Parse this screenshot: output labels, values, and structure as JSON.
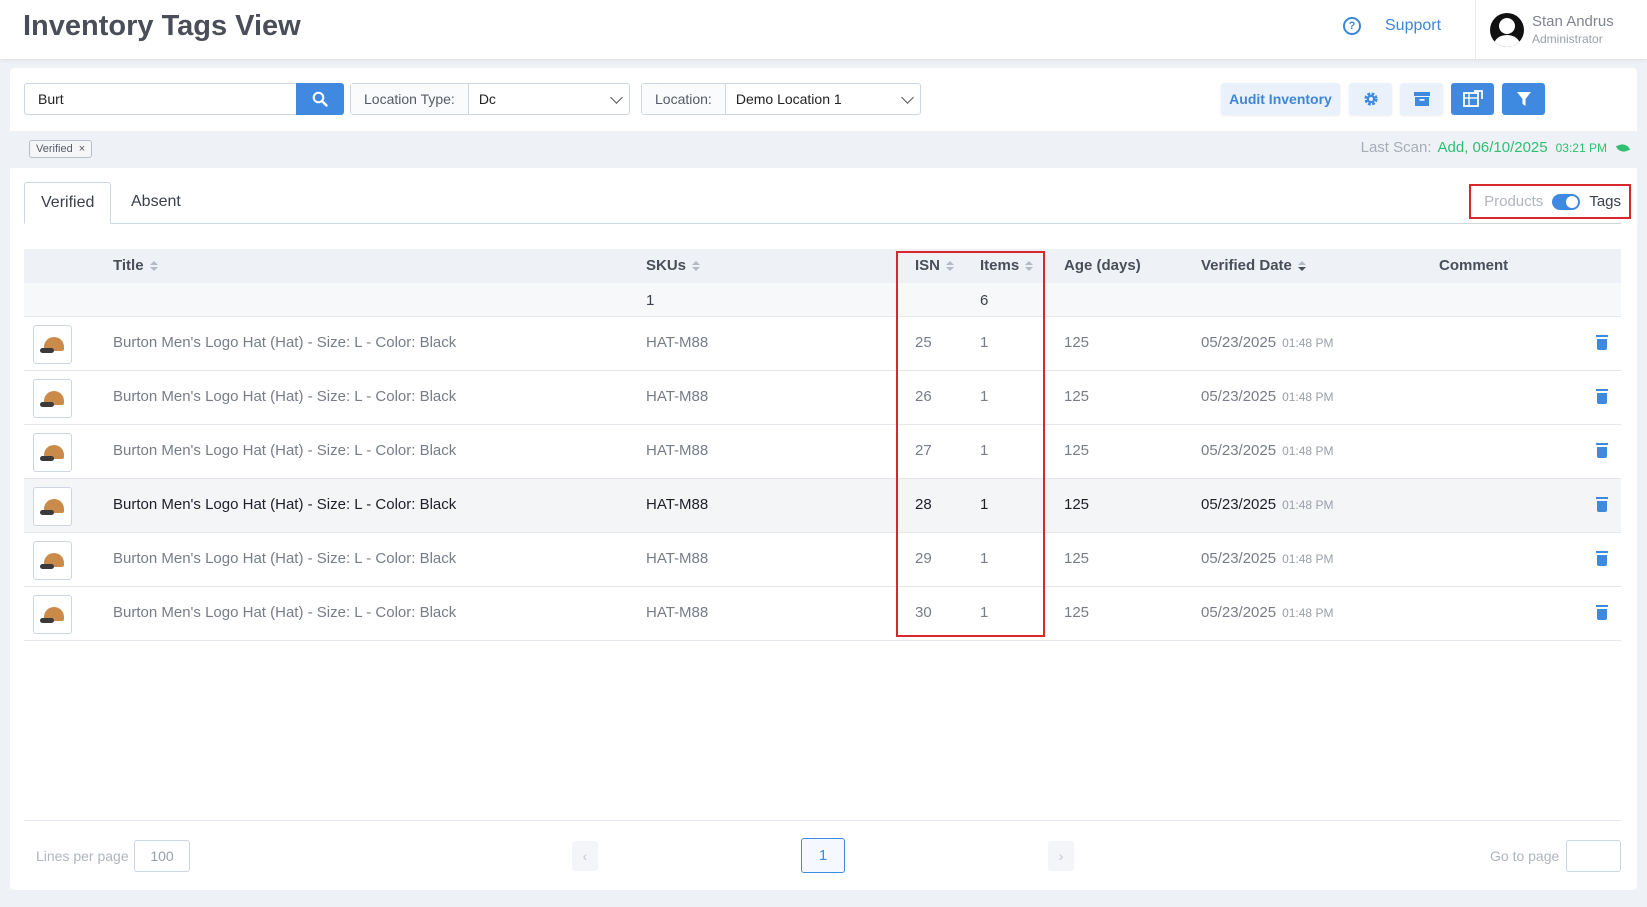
{
  "header": {
    "title": "Inventory Tags View",
    "support_label": "Support",
    "help_icon": "?",
    "user_name": "Stan Andrus",
    "user_role": "Administrator"
  },
  "toolbar": {
    "search_value": "Burt",
    "location_type_label": "Location Type:",
    "location_type_value": "Dc",
    "location_label": "Location:",
    "location_value": "Demo Location 1",
    "audit_label": "Audit Inventory"
  },
  "filters": {
    "chip_label": "Verified",
    "chip_close": "×",
    "last_scan_label": "Last Scan:",
    "last_scan_value": "Add, 06/10/2025",
    "last_scan_time": "03:21 PM"
  },
  "tabs": [
    {
      "label": "Verified"
    },
    {
      "label": "Absent"
    }
  ],
  "toggle": {
    "off_label": "Products",
    "on_label": "Tags",
    "state": "on"
  },
  "table": {
    "columns": [
      "Title",
      "SKUs",
      "ISN",
      "Items",
      "Age (days)",
      "Verified Date",
      "Comment"
    ],
    "summary": {
      "skus": "1",
      "items": "6"
    },
    "rows": [
      {
        "title": "Burton Men's Logo Hat (Hat) - Size: L - Color: Black",
        "sku": "HAT-M88",
        "isn": "25",
        "items": "1",
        "age": "125",
        "date": "05/23/2025",
        "time": "01:48 PM"
      },
      {
        "title": "Burton Men's Logo Hat (Hat) - Size: L - Color: Black",
        "sku": "HAT-M88",
        "isn": "26",
        "items": "1",
        "age": "125",
        "date": "05/23/2025",
        "time": "01:48 PM"
      },
      {
        "title": "Burton Men's Logo Hat (Hat) - Size: L - Color: Black",
        "sku": "HAT-M88",
        "isn": "27",
        "items": "1",
        "age": "125",
        "date": "05/23/2025",
        "time": "01:48 PM"
      },
      {
        "title": "Burton Men's Logo Hat (Hat) - Size: L - Color: Black",
        "sku": "HAT-M88",
        "isn": "28",
        "items": "1",
        "age": "125",
        "date": "05/23/2025",
        "time": "01:48 PM"
      },
      {
        "title": "Burton Men's Logo Hat (Hat) - Size: L - Color: Black",
        "sku": "HAT-M88",
        "isn": "29",
        "items": "1",
        "age": "125",
        "date": "05/23/2025",
        "time": "01:48 PM"
      },
      {
        "title": "Burton Men's Logo Hat (Hat) - Size: L - Color: Black",
        "sku": "HAT-M88",
        "isn": "30",
        "items": "1",
        "age": "125",
        "date": "05/23/2025",
        "time": "01:48 PM"
      }
    ]
  },
  "pagination": {
    "lines_label": "Lines per page",
    "lines_value": "100",
    "prev_arrow": "‹",
    "next_arrow": "›",
    "current_page": "1",
    "goto_label": "Go to page"
  },
  "colors": {
    "accent": "#3f8ae0",
    "highlight": "#d9272e",
    "success": "#2fbf71"
  }
}
